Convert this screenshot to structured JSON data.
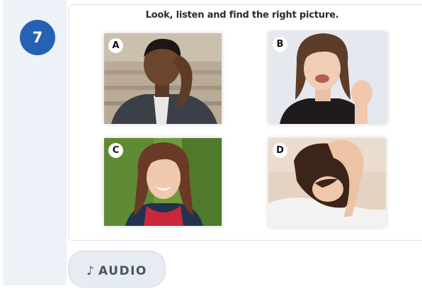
{
  "question": {
    "number": "7",
    "instruction": "Look, listen and find the right picture."
  },
  "options": [
    {
      "label": "A",
      "icon": "photo-boy-head-in-hand"
    },
    {
      "label": "B",
      "icon": "photo-girl-angry-fist"
    },
    {
      "label": "C",
      "icon": "photo-woman-smiling"
    },
    {
      "label": "D",
      "icon": "photo-girl-sad-head-down"
    }
  ],
  "audio": {
    "icon": "music-note-icon",
    "glyph": "♪",
    "label": "AUDIO"
  },
  "colors": {
    "badge": "#2463b4",
    "rail": "#edf2f8",
    "audio_bg": "#e6ecf2",
    "audio_text": "#4a5560"
  }
}
